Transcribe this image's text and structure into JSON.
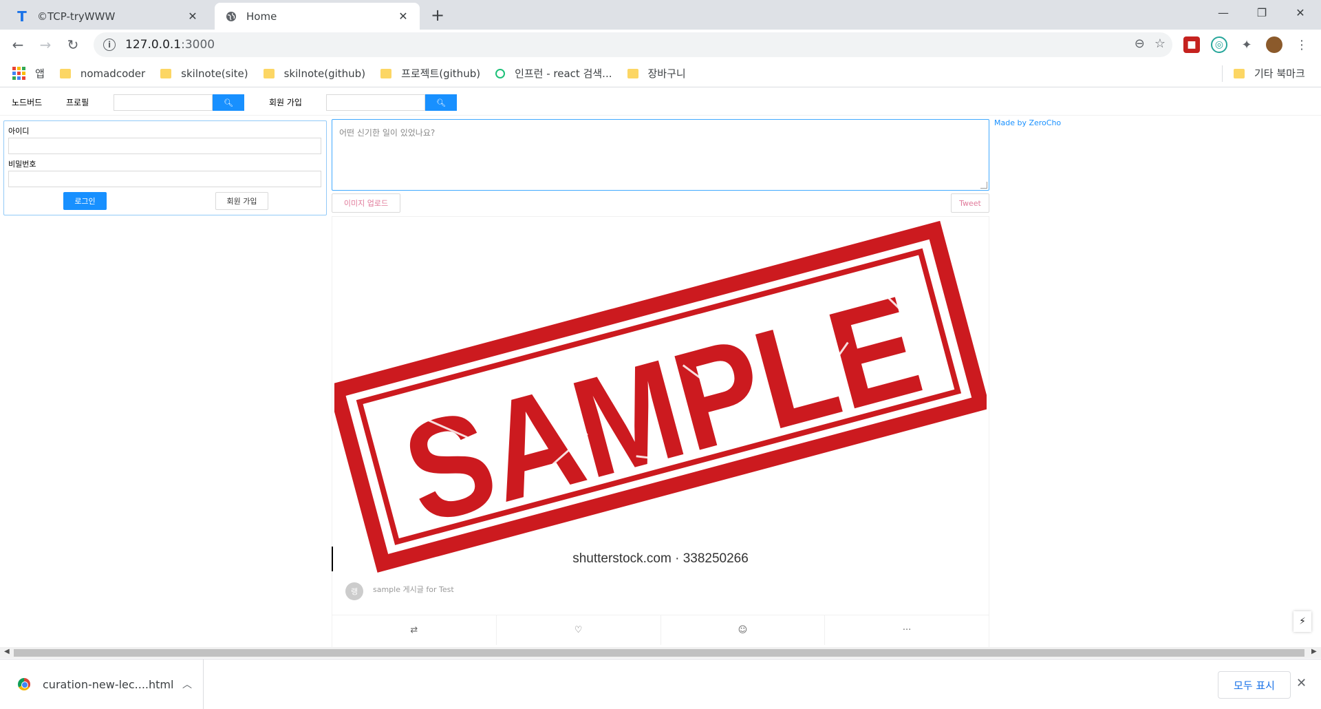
{
  "browser": {
    "tabs": [
      {
        "title": "©TCP-tryWWW",
        "favicon": "T",
        "active": false
      },
      {
        "title": "Home",
        "favicon": "globe-icon",
        "active": true
      }
    ],
    "url_host": "127.0.0.1",
    "url_port": ":3000",
    "bookmarks": [
      {
        "label": "앱",
        "icon": "apps-icon"
      },
      {
        "label": "nomadcoder",
        "icon": "folder-icon"
      },
      {
        "label": "skilnote(site)",
        "icon": "folder-icon"
      },
      {
        "label": "skilnote(github)",
        "icon": "folder-icon"
      },
      {
        "label": "프로젝트(github)",
        "icon": "folder-icon"
      },
      {
        "label": "인프런 - react 검색...",
        "icon": "inflearn-icon"
      },
      {
        "label": "장바구니",
        "icon": "folder-icon"
      }
    ],
    "other_bookmarks": "기타 북마크"
  },
  "app": {
    "menu": {
      "nodebird": "노드버드",
      "profile": "프로필",
      "signup": "회원 가입"
    },
    "login": {
      "id_label": "아이디",
      "password_label": "비밀번호",
      "login_button": "로그인",
      "signup_button": "회원 가입"
    },
    "post_form": {
      "placeholder": "어떤 신기한 일이 있었나요?",
      "upload_button": "이미지 업로드",
      "tweet_button": "Tweet"
    },
    "made_by": "Made by ZeroCho",
    "post": {
      "image_text": "SAMPLE",
      "caption": "shutterstock.com · 338250266",
      "avatar_initial": "랭",
      "text": "sample 게시글 for Test",
      "actions": [
        "retweet-icon",
        "heart-icon",
        "message-icon",
        "ellipsis-icon"
      ]
    }
  },
  "download": {
    "filename": "curation-new-lec....html",
    "show_all": "모두 표시"
  },
  "colors": {
    "primary": "#1890ff",
    "stamp_red": "#cc1a1f",
    "tab_strip": "#dee1e6"
  }
}
